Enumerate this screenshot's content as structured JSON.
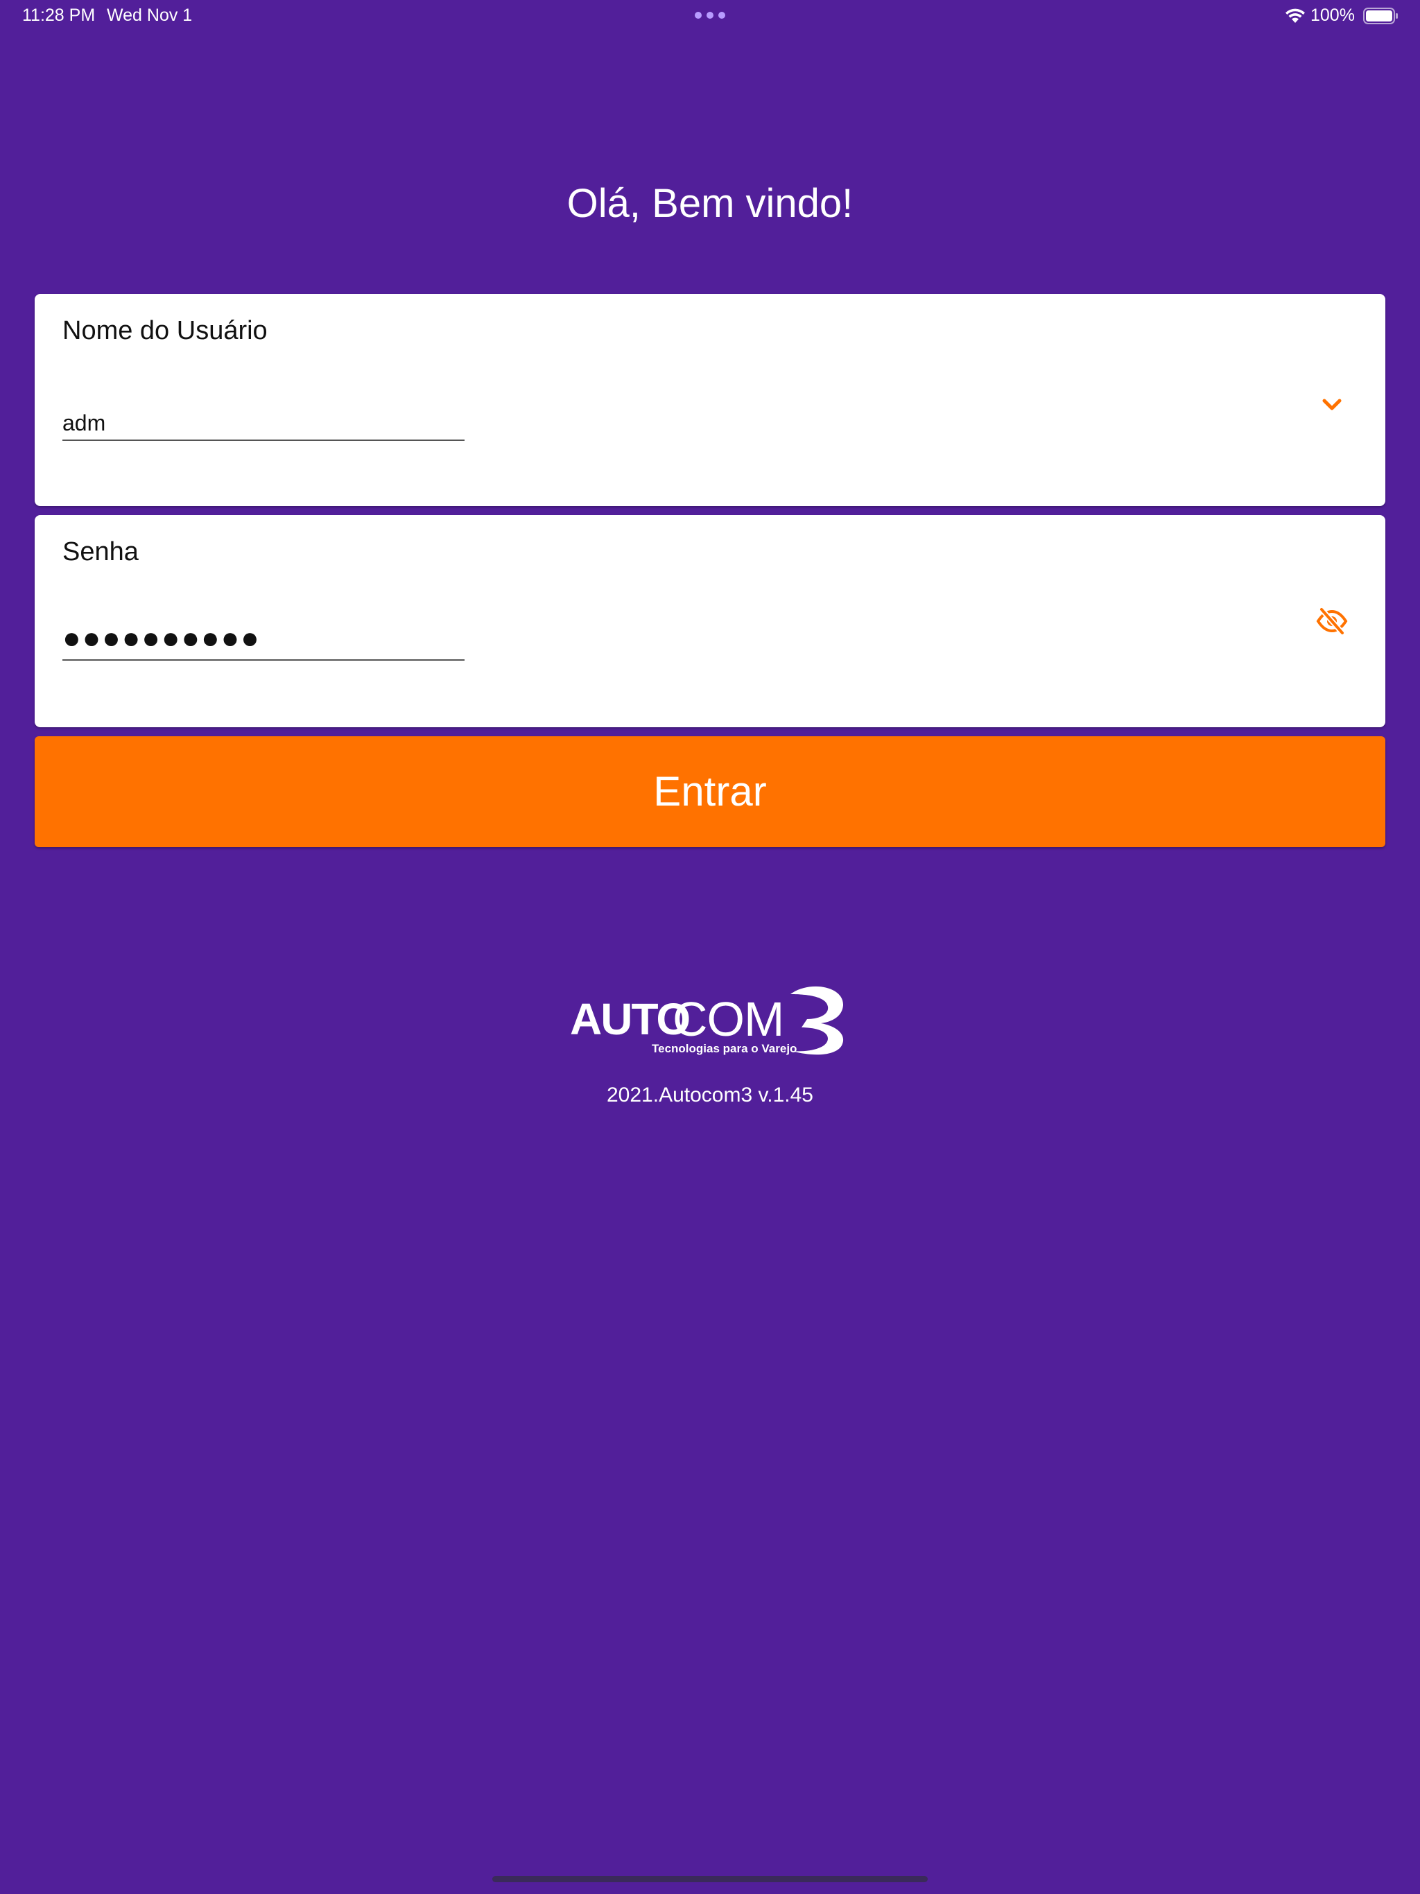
{
  "status_bar": {
    "time": "11:28 PM",
    "date": "Wed Nov 1",
    "battery_percent": "100%",
    "battery_level": 1.0
  },
  "greeting": "Olá, Bem vindo!",
  "username_field": {
    "label": "Nome do Usuário",
    "value": "adm",
    "icon": "chevron-down-icon"
  },
  "password_field": {
    "label": "Senha",
    "masked_value": "●●●●●●●●●●",
    "icon": "eye-off-icon"
  },
  "login_button": {
    "label": "Entrar"
  },
  "logo": {
    "brand_text": "AUTOCOM3",
    "tagline": "Tecnologias para o Varejo"
  },
  "version": "2021.Autocom3 v.1.45",
  "colors": {
    "background": "#521f9a",
    "accent": "#ff7200",
    "card": "#ffffff"
  }
}
